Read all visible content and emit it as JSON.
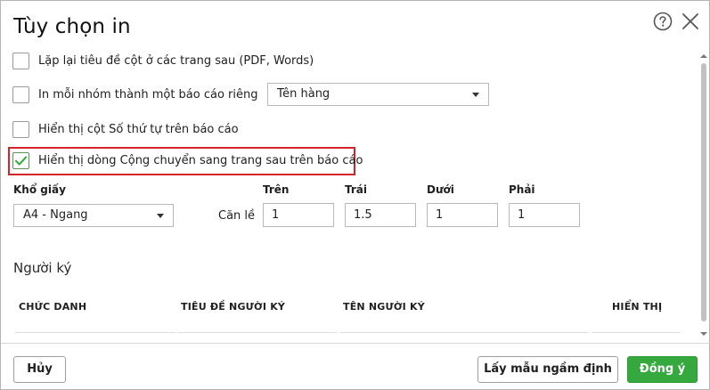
{
  "dialog": {
    "title": "Tùy chọn in"
  },
  "options": {
    "repeat_header": "Lặp lại tiêu đề cột ở các trang sau (PDF, Words)",
    "group_print": "In mỗi nhóm thành một báo cáo riêng",
    "group_select_value": "Tên hàng",
    "show_index": "Hiển thị cột Số thứ tự trên báo cáo",
    "show_carry": "Hiển thị dòng Cộng chuyển sang trang sau trên báo cáo",
    "repeat_header_checked": false,
    "group_print_checked": false,
    "show_index_checked": false,
    "show_carry_checked": true
  },
  "paper": {
    "label": "Khổ giấy",
    "value": "A4 - Ngang"
  },
  "margins": {
    "label": "Căn lề",
    "top_label": "Trên",
    "left_label": "Trái",
    "bottom_label": "Dưới",
    "right_label": "Phải",
    "top": "1",
    "left": "1.5",
    "bottom": "1",
    "right": "1"
  },
  "signers": {
    "title": "Người ký",
    "columns": [
      "CHỨC DANH",
      "TIÊU ĐỀ NGƯỜI KÝ",
      "TÊN NGƯỜI KÝ",
      "HIỂN THỊ"
    ]
  },
  "footer": {
    "cancel": "Hủy",
    "default": "Lấy mẫu ngầm định",
    "ok": "Đồng ý"
  },
  "colors": {
    "accent": "#35a93d",
    "highlight": "#d6222a"
  }
}
